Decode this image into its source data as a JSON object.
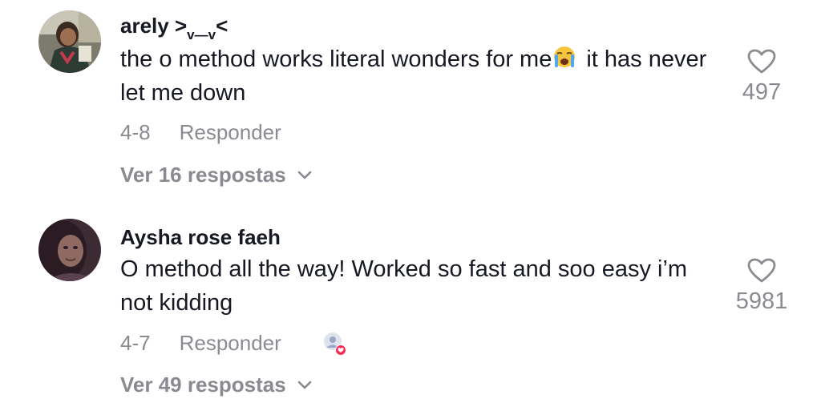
{
  "comments": [
    {
      "username": "arely >",
      "username_sub": "v—v",
      "username_tail": "<",
      "text_before": "the o method works literal wonders for me",
      "emoji": "crying-face-emoji",
      "text_after": "it has never let me down",
      "date": "4-8",
      "reply_label": "Responder",
      "view_replies": "Ver 16 respostas",
      "likes": "497"
    },
    {
      "username": "Aysha rose faeh",
      "text": "O method all the way! Worked so fast and soo easy i’m not kidding",
      "date": "4-7",
      "reply_label": "Responder",
      "creator_liked": true,
      "view_replies": "Ver 49 respostas",
      "likes": "5981"
    }
  ],
  "colors": {
    "text": "#161823",
    "muted": "#8a8b91",
    "heart_outline": "#8a8b91",
    "creator_like_badge": "#fe2c55"
  }
}
